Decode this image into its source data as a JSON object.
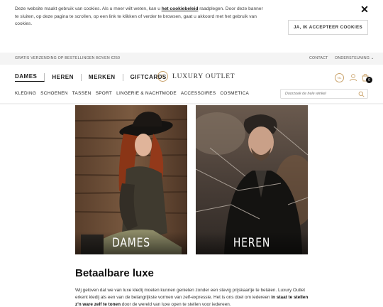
{
  "cookie": {
    "text_before": "Deze website maakt gebruik van cookies. Als u meer wilt weten, kan u ",
    "link": "het cookiebeleid",
    "text_after": " raadplegen. Door deze banner te sluiten, op deze pagina te scrollen, op een link te klikken of verder te browsen, gaat u akkoord met het gebruik van cookies.",
    "accept_label": "JA, IK ACCEPTEER COOKIES",
    "close_symbol": "✕"
  },
  "topbar": {
    "shipping": "GRATIS VERZENDING OP BESTELLINGEN BOVEN €250",
    "contact": "CONTACT",
    "support": "ONDERSTEUNING ⌄"
  },
  "header": {
    "nav": [
      "DAMES",
      "HEREN",
      "MERKEN",
      "GIFTCARDS"
    ],
    "logo_mark": "L",
    "logo_text": "LUXURY OUTLET",
    "lang": "NL",
    "cart_count": "0",
    "subnav": [
      "KLEDING",
      "SCHOENEN",
      "TASSEN",
      "SPORT",
      "LINGERIE & NACHTMODE",
      "ACCESSOIRES",
      "COSMETICA"
    ],
    "search_placeholder": "Doorzoek de hele winkel"
  },
  "tiles": [
    {
      "label": "DAMES"
    },
    {
      "label": "HEREN"
    }
  ],
  "section": {
    "title": "Betaalbare luxe",
    "body_1": "Wij geloven dat we van luxe kledij moeten kunnen genieten zonder een stevig prijskaartje te betalen. Luxury Outlet erkent kledij als een van de belangrijkste vormen van zelf-expressie. Het is ons doel om iedereen ",
    "body_bold": "in staat te stellen z'n ware zelf te tonen",
    "body_2": " door de wereld van luxe open te stellen voor iedereen."
  },
  "colors": {
    "accent_gold": "#c9a26a",
    "topbar_bg": "#f4f4f4",
    "text_dark": "#111111"
  }
}
